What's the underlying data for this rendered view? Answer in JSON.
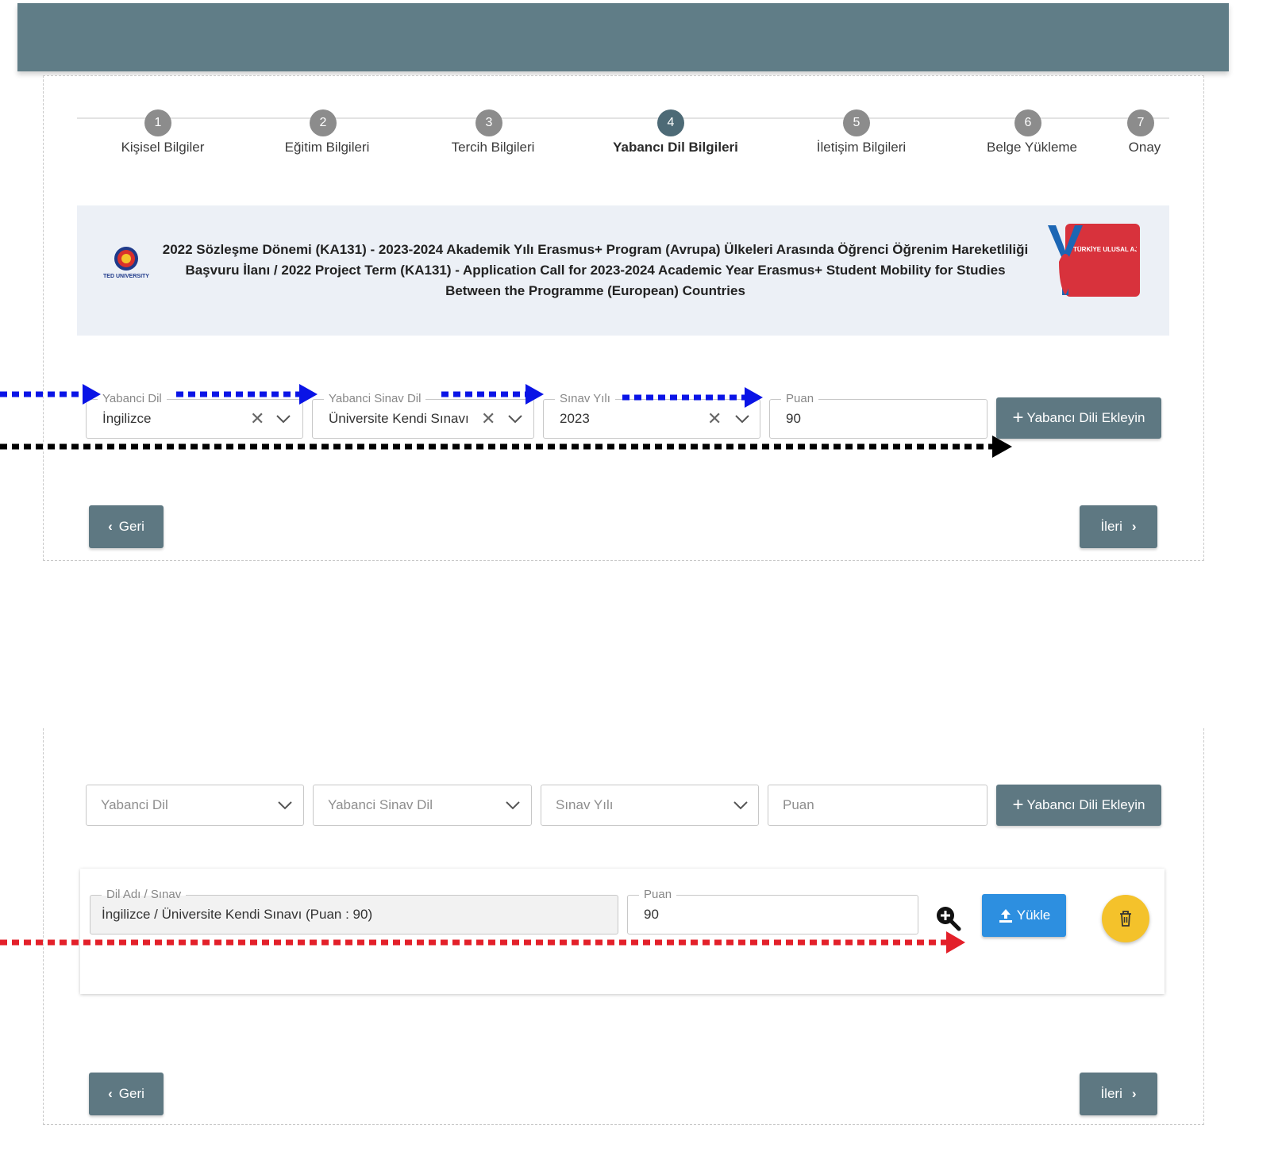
{
  "stepper": {
    "steps": [
      {
        "number": "1",
        "label": "Kişisel Bilgiler"
      },
      {
        "number": "2",
        "label": "Eğitim Bilgileri"
      },
      {
        "number": "3",
        "label": "Tercih Bilgileri"
      },
      {
        "number": "4",
        "label": "Yabancı Dil Bilgileri"
      },
      {
        "number": "5",
        "label": "İletişim Bilgileri"
      },
      {
        "number": "6",
        "label": "Belge Yükleme"
      },
      {
        "number": "7",
        "label": "Onay"
      }
    ],
    "active_step": 4
  },
  "banner": {
    "title_line1": "2022 Sözleşme Dönemi (KA131) - 2023-2024 Akademik Yılı Erasmus+ Program (Avrupa) Ülkeleri Arasında Öğrenci Öğrenim Hareketliliği",
    "title_line2": "Başvuru İlanı / 2022 Project Term (KA131) - Application Call for 2023-2024 Academic Year Erasmus+ Student Mobility for Studies",
    "title_line3": "Between the Programme (European) Countries",
    "left_logo_text": "TED UNIVERSITY",
    "right_logo_text": "TÜRKİYE ULUSAL AJANSI"
  },
  "form_filled": {
    "language": {
      "label": "Yabanci Dil",
      "value": "İngilizce"
    },
    "exam": {
      "label": "Yabanci Sinav Dil",
      "value": "Üniversite Kendi Sınavı"
    },
    "year": {
      "label": "Sınav Yılı",
      "value": "2023"
    },
    "score": {
      "label": "Puan",
      "value": "90"
    },
    "add_button": "Yabancı Dili Ekleyin"
  },
  "form_empty": {
    "language_placeholder": "Yabanci Dil",
    "exam_placeholder": "Yabanci Sinav Dil",
    "year_placeholder": "Sınav Yılı",
    "score_placeholder": "Puan",
    "add_button": "Yabancı Dili Ekleyin"
  },
  "entry_card": {
    "name_label": "Dil Adı / Sınav",
    "name_value": "İngilizce / Üniversite Kendi Sınavı (Puan : 90)",
    "score_label": "Puan",
    "score_value": "90",
    "upload_button": "Yükle"
  },
  "nav": {
    "back": "Geri",
    "next": "İleri"
  },
  "colors": {
    "header": "#607d87",
    "primary_button": "#5e7882",
    "upload_button": "#2d8fe0",
    "delete_button": "#f4c22b",
    "arrow_blue": "#0a14e6",
    "arrow_black": "#000000",
    "arrow_red": "#e3202a"
  },
  "icons": [
    "zoom-in-icon",
    "upload-icon",
    "trash-icon",
    "plus-icon",
    "chevron-down-icon",
    "clear-icon",
    "chevron-left-icon",
    "chevron-right-icon"
  ]
}
